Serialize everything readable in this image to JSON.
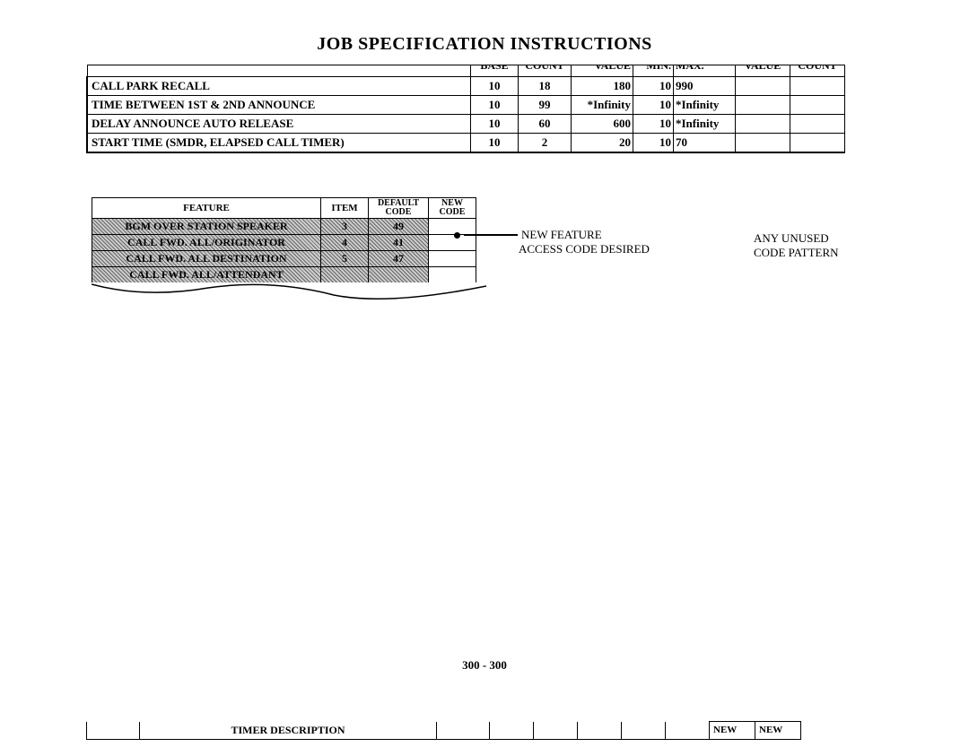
{
  "title": "JOB SPECIFICATION INSTRUCTIONS",
  "table1": {
    "headers": [
      "BASE",
      "COUNT",
      "VALUE",
      "MIN.",
      "MAX.",
      "VALUE",
      "COUNT"
    ],
    "rows": [
      {
        "desc": "CALL PARK RECALL",
        "base": "10",
        "count": "18",
        "value": "180",
        "min": "10",
        "max": "990"
      },
      {
        "desc": "TIME BETWEEN 1ST & 2ND ANNOUNCE",
        "base": "10",
        "count": "99",
        "value": "*Infinity",
        "min": "10",
        "max": "*Infinity"
      },
      {
        "desc": "DELAY ANNOUNCE AUTO RELEASE",
        "base": "10",
        "count": "60",
        "value": "600",
        "min": "10",
        "max": "*Infinity"
      },
      {
        "desc": "START TIME (SMDR, ELAPSED CALL TIMER)",
        "base": "10",
        "count": "2",
        "value": "20",
        "min": "10",
        "max": "70"
      }
    ]
  },
  "table2": {
    "headers": {
      "0": "FEATURE",
      "1": "ITEM",
      "2a": "DEFAULT",
      "2b": "CODE",
      "3a": "NEW",
      "3b": "CODE"
    },
    "rows": [
      {
        "feature": "BGM OVER STATION SPEAKER",
        "item": "3",
        "dcode": "49"
      },
      {
        "feature": "CALL FWD. ALL/ORIGINATOR",
        "item": "4",
        "dcode": "41"
      },
      {
        "feature": "CALL FWD. ALL DESTINATION",
        "item": "5",
        "dcode": "47"
      },
      {
        "feature": "CALL FWD. ALL/ATTENDANT",
        "item": "",
        "dcode": ""
      }
    ]
  },
  "callouts": {
    "left": [
      "NEW FEATURE",
      "ACCESS CODE DESIRED"
    ],
    "right": [
      "ANY UNUSED",
      "CODE PATTERN"
    ]
  },
  "footer": "300 - 300",
  "table3": {
    "desc": "TIMER DESCRIPTION",
    "new1": "NEW",
    "new2": "NEW"
  }
}
